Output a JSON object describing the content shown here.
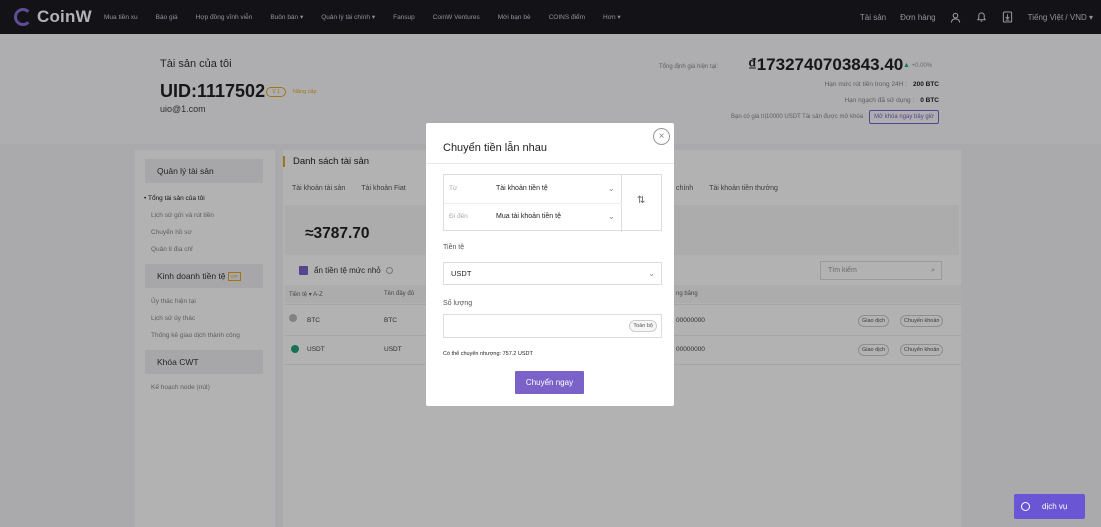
{
  "nav": {
    "brand": "CoinW",
    "items": [
      "Mua tiền xu",
      "Báo giá",
      "Hợp đồng vĩnh viễn",
      "Buôn bán ▾",
      "Quản lý tài chính ▾",
      "Fansup",
      "CoinW Ventures",
      "Mời bạn bè",
      "COINS điểm",
      "Hơn ▾"
    ],
    "assets": "Tài sản",
    "orders": "Đơn hàng",
    "language": "Tiếng Việt / VND ▾"
  },
  "header": {
    "title": "Tài sản của tôi",
    "uid": "UID:1117502",
    "vip": "V 1",
    "upgrade": "Nâng cấp",
    "email": "uio@1.com",
    "valuation_label": "Tổng định giá hiện tại:",
    "valuation": "₫1732740703843.40",
    "valuation_change": "+0.00%",
    "withdraw_label": "Hạn mức rút tiền trong 24H :",
    "withdraw_value": "200 BTC",
    "used_label": "Hạn ngạch đã sử dụng :",
    "used_value": "0 BTC",
    "unlock_text": "Bạn có giá trị10000 USDT Tài sản được mở khóa",
    "unlock_button": "Mở khóa ngay bây giờ"
  },
  "sidebar": {
    "group1": "Quản lý tài sản",
    "items1": [
      "Tổng tài sản của tôi",
      "Lịch sử gửi và rút tiền",
      "Chuyển hồ sơ",
      "Quản lí địa chỉ"
    ],
    "group2": "Kinh doanh tiền tệ",
    "group2_badge": "VIP",
    "items2": [
      "Ủy thác hiện tại",
      "Lịch sử ủy thác",
      "Thống kê giao dịch thành công"
    ],
    "group3": "Khóa CWT",
    "items3": [
      "Kế hoạch node (nút)"
    ]
  },
  "main": {
    "title": "Danh sách tài sản",
    "tabs": [
      "Tài khoản tài sản",
      "Tài khoản Fiat"
    ],
    "tabs_right": [
      "chính",
      "Tài khoản tiền thưởng"
    ],
    "balance": "≈3787.70",
    "hide_small": "ẩn tiền tệ mức nhỏ",
    "search_placeholder": "Tìm kiếm",
    "headers": [
      "Tiền tệ ▾ A-Z",
      "Tên đầy đủ",
      "ng băng"
    ],
    "rows": [
      {
        "coin": "BTC",
        "name": "BTC",
        "frozen": "00000000",
        "trade": "Giao dịch",
        "transfer": "Chuyển khoản"
      },
      {
        "coin": "USDT",
        "name": "USDT",
        "frozen": "00000000",
        "trade": "Giao dịch",
        "transfer": "Chuyển khoản"
      }
    ]
  },
  "modal": {
    "title": "Chuyển tiền lẫn nhau",
    "from_label": "Từ",
    "from_value": "Tài khoản tiền tệ",
    "to_label": "Đi đến",
    "to_value": "Mua tài khoản tiền tệ",
    "currency_label": "Tiền tệ",
    "currency_value": "USDT",
    "quantity_label": "Số lượng",
    "all_button": "Toàn bộ",
    "available": "Có thể chuyển nhượng: 757.2 USDT",
    "submit": "Chuyển ngay"
  },
  "chat": {
    "label": "dịch vụ"
  },
  "colors": {
    "accent": "#7b62c9",
    "gold": "#e6a821",
    "nav_bg": "#1a1a22"
  }
}
